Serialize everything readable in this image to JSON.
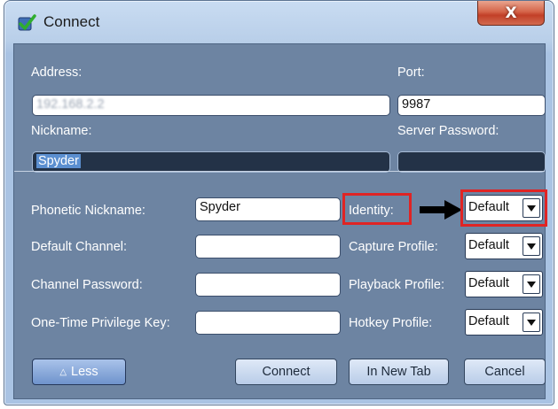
{
  "window": {
    "title": "Connect",
    "close_label": "X"
  },
  "form": {
    "address_label": "Address:",
    "address_value": "192.168.2.2",
    "port_label": "Port:",
    "port_value": "9987",
    "nickname_label": "Nickname:",
    "nickname_value": "Spyder",
    "server_password_label": "Server Password:",
    "server_password_value": "",
    "phonetic_nickname_label": "Phonetic Nickname:",
    "phonetic_nickname_value": "Spyder",
    "default_channel_label": "Default Channel:",
    "default_channel_value": "",
    "channel_password_label": "Channel Password:",
    "channel_password_value": "",
    "privilege_key_label": "One-Time Privilege Key:",
    "privilege_key_value": "",
    "identity_label": "Identity:",
    "identity_value": "Default",
    "capture_profile_label": "Capture Profile:",
    "capture_profile_value": "Default",
    "playback_profile_label": "Playback Profile:",
    "playback_profile_value": "Default",
    "hotkey_profile_label": "Hotkey Profile:",
    "hotkey_profile_value": "Default"
  },
  "buttons": {
    "less_label": "Less",
    "connect_label": "Connect",
    "new_tab_label": "In New Tab",
    "cancel_label": "Cancel"
  },
  "annotation": {
    "color": "#e02424"
  },
  "colors": {
    "client_bg": "#6d84a2",
    "titlebar": "#b9cfe9"
  }
}
